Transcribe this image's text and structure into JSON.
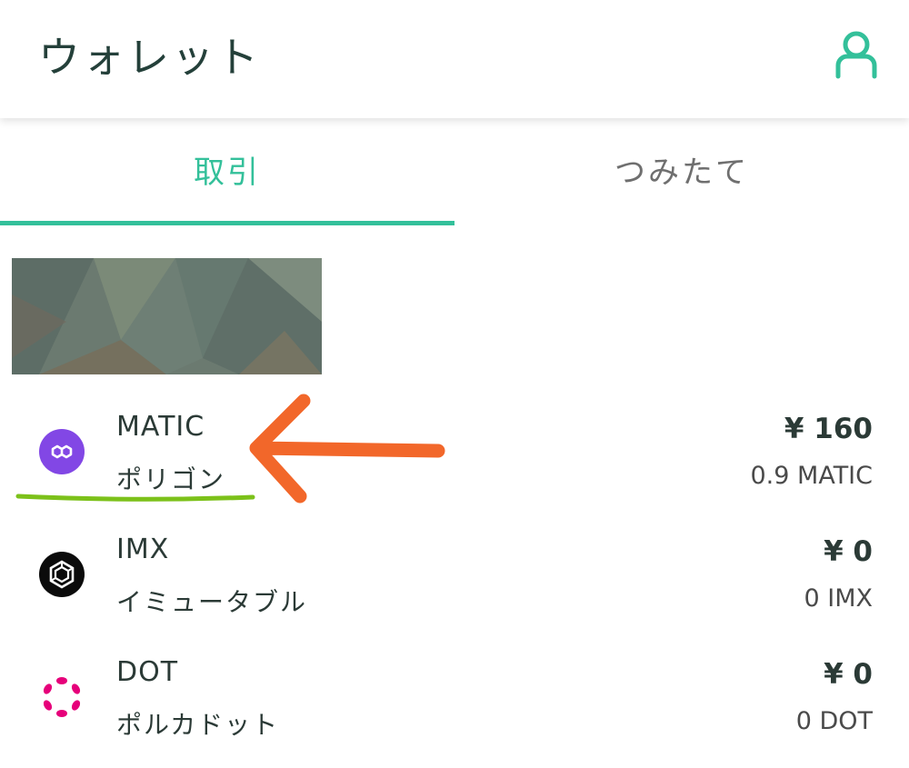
{
  "header": {
    "title": "ウォレット",
    "profile_icon": "person-icon"
  },
  "tabs": [
    {
      "label": "取引",
      "active": true
    },
    {
      "label": "つみたて",
      "active": false
    }
  ],
  "colors": {
    "accent": "#33c09a",
    "annotation_arrow": "#f2672a",
    "annotation_underline": "#7cc11a"
  },
  "assets": [
    {
      "symbol": "MATIC",
      "name_jp": "ポリゴン",
      "yen": "¥ 160",
      "amount": "0.9 MATIC",
      "icon": "polygon-icon",
      "icon_color": "#8247e5"
    },
    {
      "symbol": "IMX",
      "name_jp": "イミュータブル",
      "yen": "¥ 0",
      "amount": "0 IMX",
      "icon": "immutable-icon",
      "icon_color": "#000000"
    },
    {
      "symbol": "DOT",
      "name_jp": "ポルカドット",
      "yen": "¥ 0",
      "amount": "0 DOT",
      "icon": "polkadot-icon",
      "icon_color": "#e6007a"
    }
  ]
}
